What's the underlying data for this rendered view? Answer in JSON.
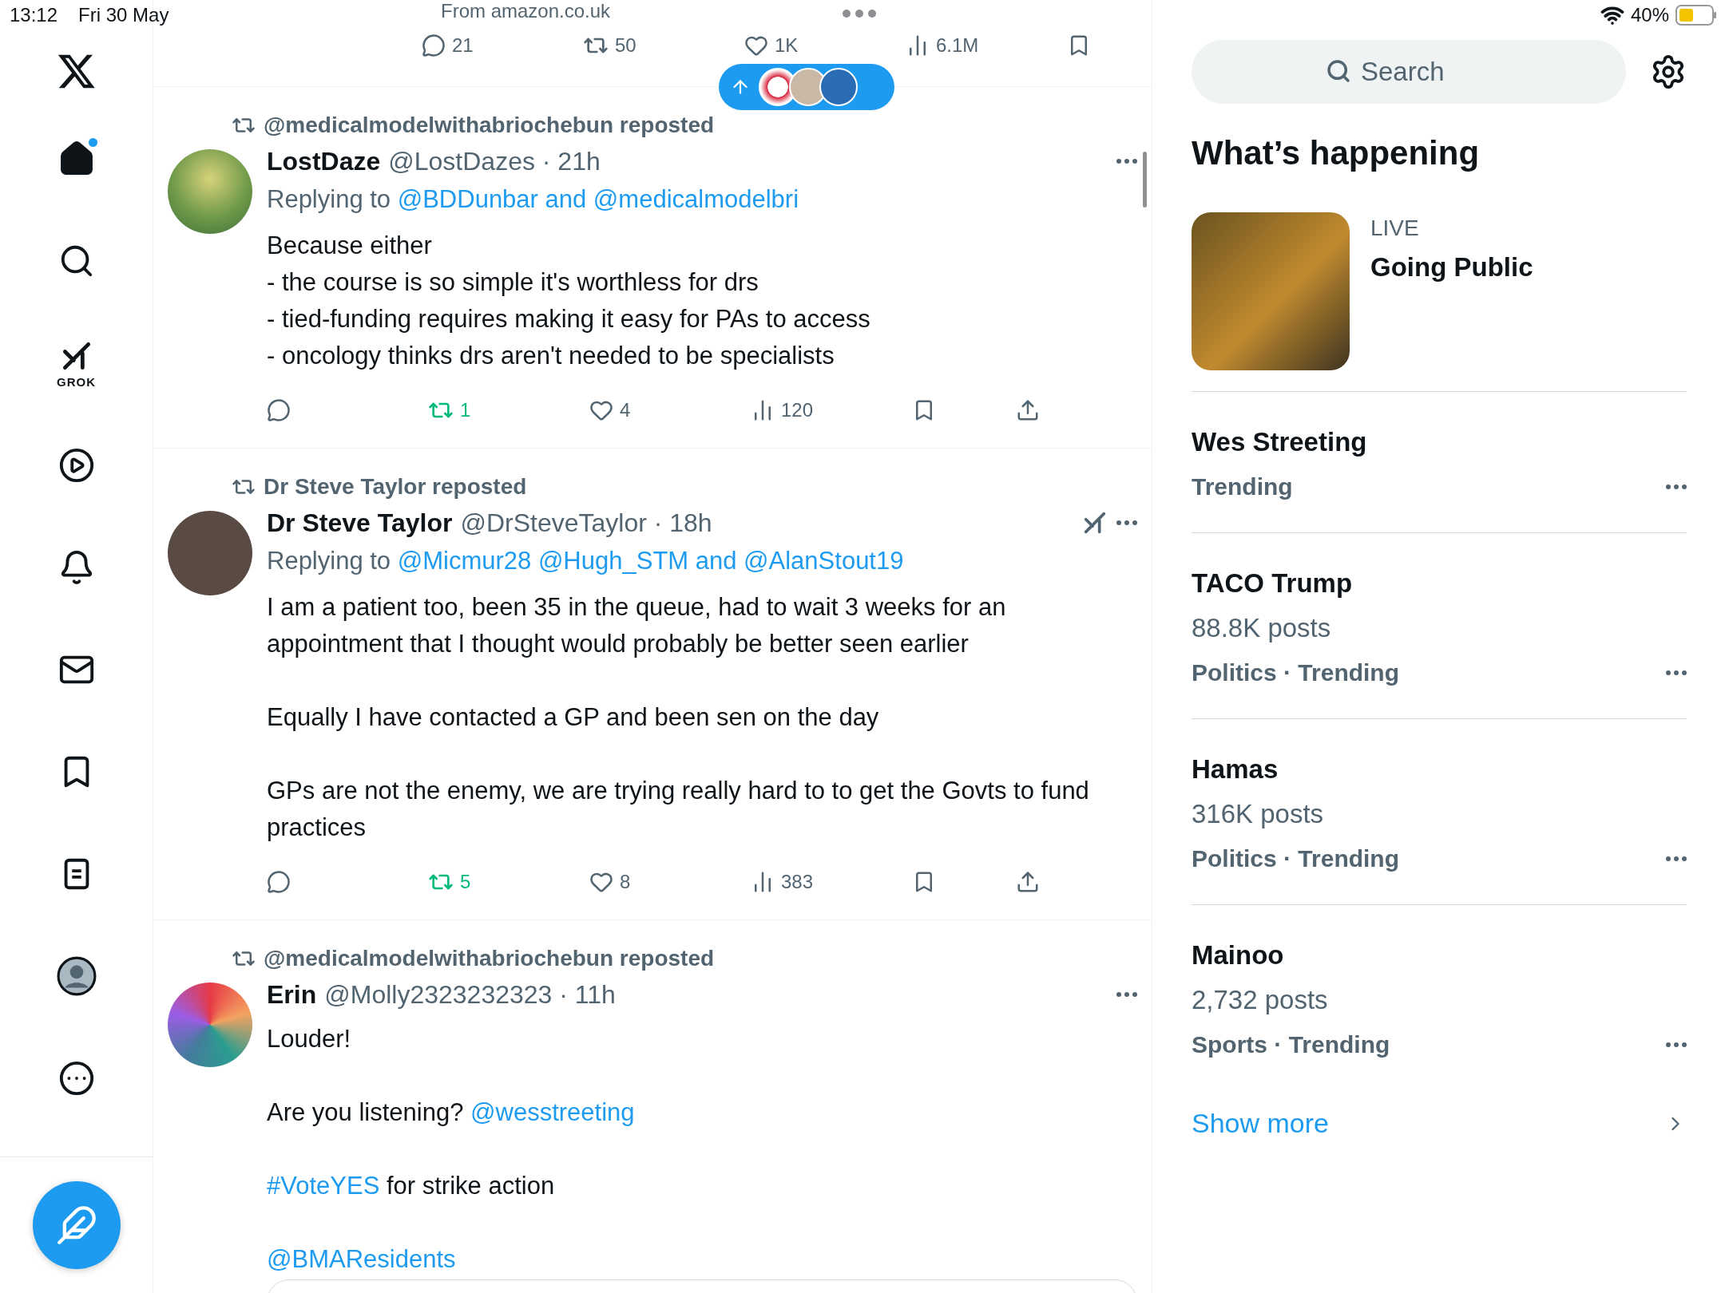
{
  "status_bar": {
    "time": "13:12",
    "date": "Fri 30 May",
    "battery": "40%"
  },
  "nav": {
    "grok_label": "GROK",
    "items": [
      {
        "kind": "home",
        "selected": true,
        "unread": true
      },
      {
        "kind": "explore",
        "selected": false,
        "unread": false
      },
      {
        "kind": "grok",
        "selected": false,
        "unread": false
      },
      {
        "kind": "video",
        "selected": false,
        "unread": false
      },
      {
        "kind": "notifications",
        "selected": false,
        "unread": false
      },
      {
        "kind": "messages",
        "selected": false,
        "unread": false
      },
      {
        "kind": "bookmarks",
        "selected": false,
        "unread": false
      },
      {
        "kind": "lists",
        "selected": false,
        "unread": false
      },
      {
        "kind": "profile",
        "selected": false,
        "unread": false
      },
      {
        "kind": "more",
        "selected": false,
        "unread": false
      }
    ]
  },
  "feed": {
    "partial_post": {
      "source": "From amazon.co.uk",
      "stats": {
        "replies": "21",
        "reposts": "50",
        "reposted": false,
        "likes": "1K",
        "views": "6.1M"
      }
    },
    "posts": [
      {
        "repost_by": "@medicalmodelwithabriochebun reposted",
        "name": "LostDaze",
        "meta": "@LostDazes · 21h",
        "grok": false,
        "replying_label": "Replying to",
        "replying_to": "@BDDunbar and @medicalmodelbri",
        "paragraphs": [
          [
            {
              "text": "Because either\n- the course is so simple it's worthless for drs\n- tied-funding requires making it easy for PAs to access\n- oncology thinks drs aren't needed to be specialists",
              "link": false
            }
          ]
        ],
        "stats": {
          "reposts": "1",
          "reposted": true,
          "likes": "4",
          "views": "120"
        }
      },
      {
        "repost_by": "Dr Steve Taylor reposted",
        "name": "Dr Steve Taylor",
        "meta": "@DrSteveTaylor · 18h",
        "grok": true,
        "replying_label": "Replying to",
        "replying_to": "@Micmur28 @Hugh_STM and @AlanStout19",
        "paragraphs": [
          [
            {
              "text": "I am a patient too, been 35 in the queue, had to wait 3 weeks for an appointment that I thought would probably be better seen earlier",
              "link": false
            }
          ],
          [
            {
              "text": "Equally I have contacted a GP and been sen on the day",
              "link": false
            }
          ],
          [
            {
              "text": "GPs are not the enemy, we are trying really hard to to get the Govts to fund practices",
              "link": false
            }
          ]
        ],
        "stats": {
          "reposts": "5",
          "reposted": true,
          "likes": "8",
          "views": "383"
        }
      },
      {
        "repost_by": "@medicalmodelwithabriochebun reposted",
        "name": "Erin",
        "meta": "@Molly2323232323 · 11h",
        "grok": false,
        "paragraphs": [
          [
            {
              "text": "Louder!",
              "link": false
            }
          ],
          [
            {
              "text": "Are you listening? ",
              "link": false
            },
            {
              "text": "@wesstreeting",
              "link": true
            }
          ],
          [
            {
              "text": "#VoteYES",
              "link": true
            },
            {
              "text": " for strike action",
              "link": false
            }
          ],
          [
            {
              "text": "@BMAResidents",
              "link": true
            }
          ]
        ],
        "link_card": true
      }
    ]
  },
  "sidebar": {
    "search": {
      "placeholder": "Search"
    },
    "heading": "What’s happening",
    "live": {
      "label": "LIVE",
      "title": "Going Public"
    },
    "trends": [
      {
        "name": "Wes Streeting",
        "meta": "Trending"
      },
      {
        "name": "TACO Trump",
        "posts": "88.8K posts",
        "meta": "Politics · Trending"
      },
      {
        "name": "Hamas",
        "posts": "316K posts",
        "meta": "Politics · Trending"
      },
      {
        "name": "Mainoo",
        "posts": "2,732 posts",
        "meta": "Sports · Trending"
      }
    ],
    "show_more": "Show more"
  }
}
